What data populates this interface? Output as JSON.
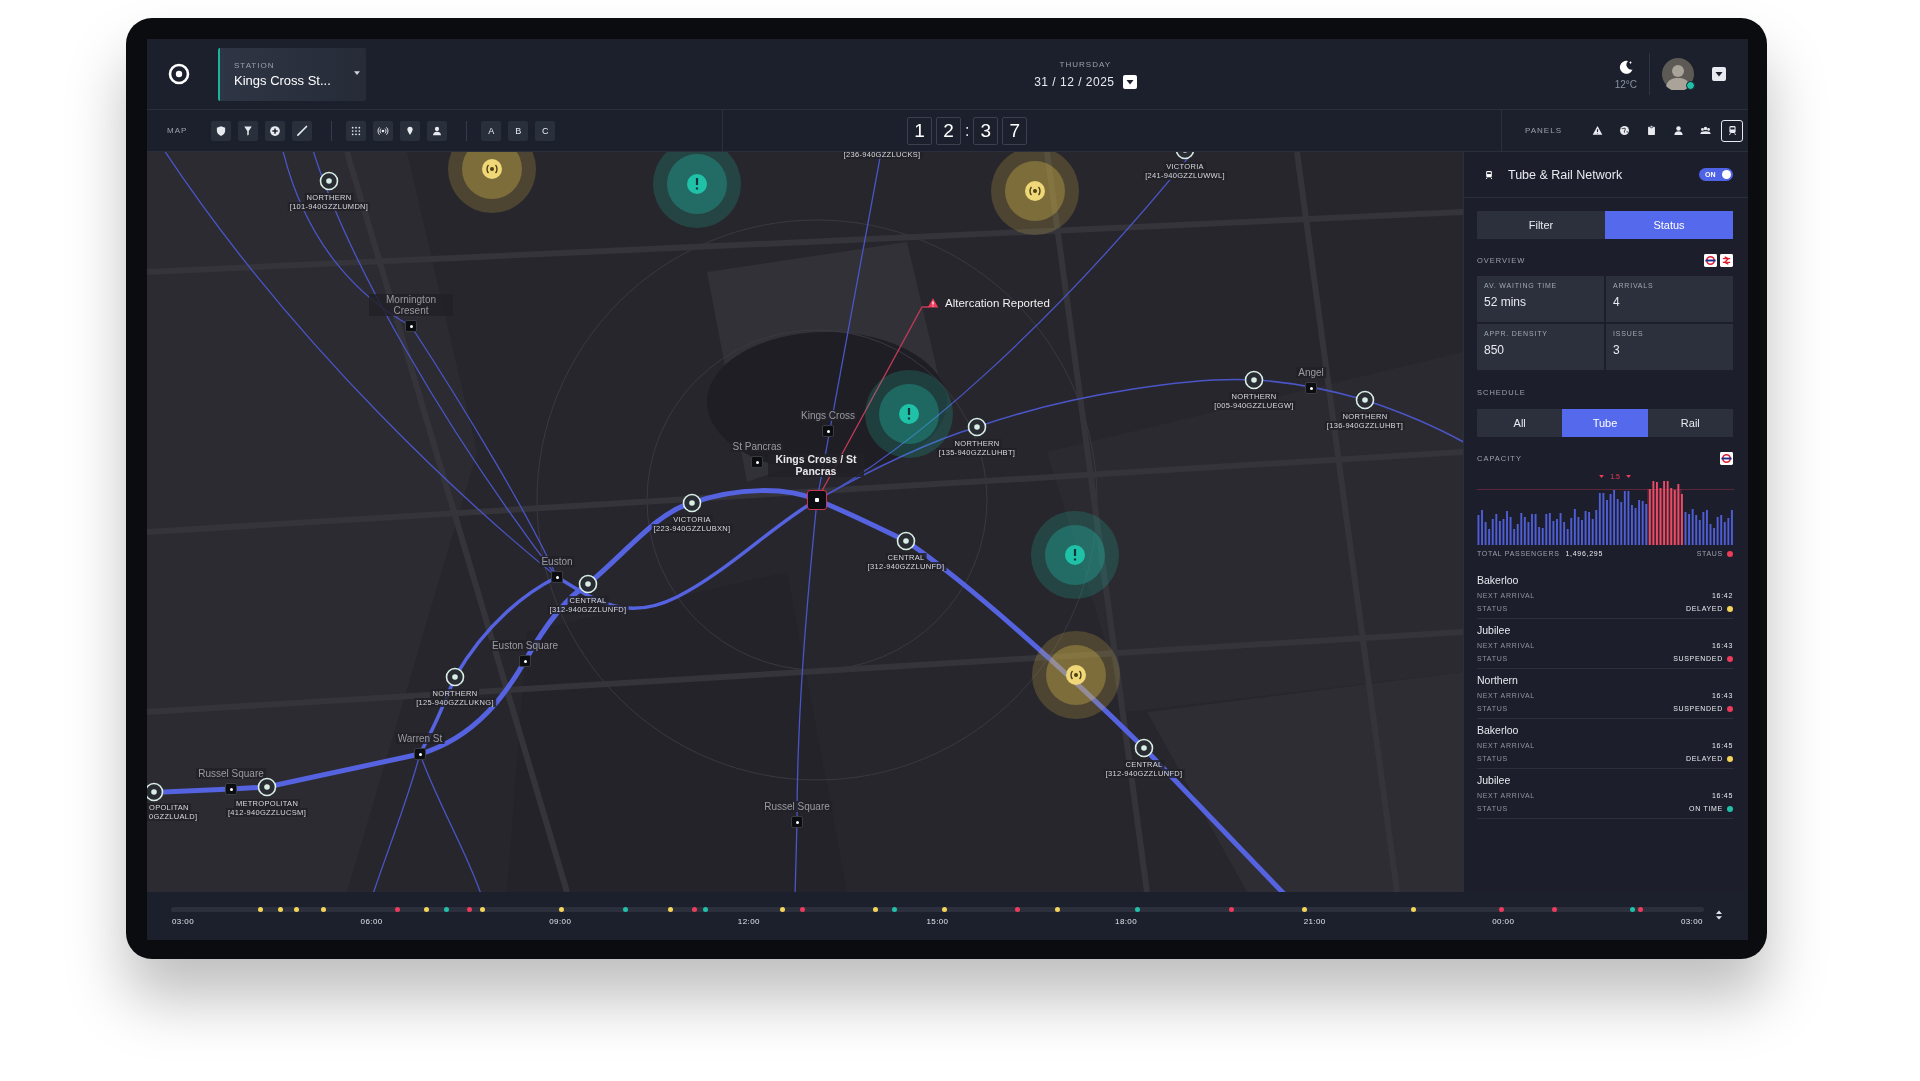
{
  "header": {
    "station_label": "STATION",
    "station": "Kings Cross St...",
    "day": "THURSDAY",
    "date": "31 / 12 / 2025",
    "temperature": "12°C",
    "user_online": true
  },
  "toolbar": {
    "map_label": "MAP",
    "layer_buttons": [
      "A",
      "B",
      "C"
    ],
    "clock": [
      "1",
      "2",
      ":",
      "3",
      "7"
    ],
    "panels_label": "PANELS",
    "panels": [
      {
        "selected": false
      },
      {
        "selected": false
      },
      {
        "selected": false
      },
      {
        "selected": false
      },
      {
        "selected": false
      },
      {
        "selected": true
      }
    ]
  },
  "map": {
    "alert": {
      "text": "Altercation Reported"
    },
    "hub": {
      "name": "Kings Cross / St Pancras"
    },
    "stations": [
      {
        "name": "Mornington Cresent"
      },
      {
        "name": "St Pancras"
      },
      {
        "name": "Kings Cross"
      },
      {
        "name": "Euston"
      },
      {
        "name": "Euston Square"
      },
      {
        "name": "Warren St"
      },
      {
        "name": "Russel Square"
      },
      {
        "name": "Russel Square"
      },
      {
        "name": "Angel"
      }
    ],
    "line_stations": [
      {
        "line": "NORTHERN",
        "code": "[101-940GZZLUMDN]"
      },
      {
        "code": "[236-940GZZLUCKS]"
      },
      {
        "line": "VICTORIA",
        "code": "[241-940GZZLUWWL]"
      },
      {
        "line": "NORTHERN",
        "code": "[005-940GZZLUEGW]"
      },
      {
        "line": "NORTHERN",
        "code": "[136-940GZZLUHBT]"
      },
      {
        "line": "NORTHERN",
        "code": "[135-940GZZLUHBT]"
      },
      {
        "line": "VICTORIA",
        "code": "[223-940GZZLUBXN]"
      },
      {
        "line": "CENTRAL",
        "code": "[312-940GZZLUNFD]"
      },
      {
        "line": "CENTRAL",
        "code": "[312-940GZZLUNFD]"
      },
      {
        "line": "NORTHERN",
        "code": "[125-940GZZLUKNG]"
      },
      {
        "line": "CENTRAL",
        "code": "[312-940GZZLUNFD]"
      },
      {
        "line": "METROPOLITAN",
        "code": "[412-940GZZLUCSM]"
      },
      {
        "line": "OPOLITAN",
        "code": "0GZZLUALD]"
      }
    ],
    "hotspots": [
      {
        "kind": "signal"
      },
      {
        "kind": "alert"
      },
      {
        "kind": "signal"
      },
      {
        "kind": "alert"
      },
      {
        "kind": "alert"
      },
      {
        "kind": "signal"
      }
    ]
  },
  "panel": {
    "title": "Tube & Rail Network",
    "toggle": {
      "label": "ON",
      "on": true
    },
    "view_tabs": [
      {
        "label": "Filter",
        "selected": false
      },
      {
        "label": "Status",
        "selected": true
      }
    ],
    "overview_label": "OVERVIEW",
    "stats": [
      {
        "label": "AV. WAITING TIME",
        "value": "52 mins"
      },
      {
        "label": "ARRIVALS",
        "value": "4"
      },
      {
        "label": "APPR. DENSITY",
        "value": "850"
      },
      {
        "label": "ISSUES",
        "value": "3"
      }
    ],
    "schedule_label": "SCHEDULE",
    "schedule_tabs": [
      {
        "label": "All",
        "selected": false
      },
      {
        "label": "Tube",
        "selected": true
      },
      {
        "label": "Rail",
        "selected": false
      }
    ],
    "capacity_label": "CAPACITY",
    "capacity_marker": "1.5",
    "total_label": "TOTAL PASSENGERS",
    "total_value": "1,496,295",
    "status_label": "STAUS",
    "status_dot": {
      "color": "#ee3b5b"
    },
    "arrivals": [
      {
        "line": "Bakerloo",
        "next_label": "NEXT ARRIVAL",
        "time": "16:42",
        "status_label": "STATUS",
        "status": "DELAYED",
        "color": "#f5d45a"
      },
      {
        "line": "Jubilee",
        "next_label": "NEXT ARRIVAL",
        "time": "16:43",
        "status_label": "STATUS",
        "status": "SUSPENDED",
        "color": "#ee3b5b"
      },
      {
        "line": "Northern",
        "next_label": "NEXT ARRIVAL",
        "time": "16:43",
        "status_label": "STATUS",
        "status": "SUSPENDED",
        "color": "#ee3b5b"
      },
      {
        "line": "Bakerloo",
        "next_label": "NEXT ARRIVAL",
        "time": "16:45",
        "status_label": "STATUS",
        "status": "DELAYED",
        "color": "#f5d45a"
      },
      {
        "line": "Jubilee",
        "next_label": "NEXT ARRIVAL",
        "time": "16:45",
        "status_label": "STATUS",
        "status": "ON TIME",
        "color": "#1fc2a7"
      }
    ]
  },
  "timeline": {
    "times": [
      "03:00",
      "06:00",
      "09:00",
      "12:00",
      "15:00",
      "18:00",
      "21:00",
      "00:00",
      "03:00"
    ],
    "events": [
      {
        "color": "#f5d45a"
      },
      {
        "color": "#f5d45a"
      },
      {
        "color": "#f5d45a"
      },
      {
        "color": "#f5d45a"
      },
      {
        "color": "#ee3b5b"
      },
      {
        "color": "#f5d45a"
      },
      {
        "color": "#1fc2a7"
      },
      {
        "color": "#ee3b5b"
      },
      {
        "color": "#f5d45a"
      },
      {
        "color": "#f5d45a"
      },
      {
        "color": "#1fc2a7"
      },
      {
        "color": "#f5d45a"
      },
      {
        "color": "#ee3b5b"
      },
      {
        "color": "#1fc2a7"
      },
      {
        "color": "#f5d45a"
      },
      {
        "color": "#ee3b5b"
      },
      {
        "color": "#f5d45a"
      },
      {
        "color": "#1fc2a7"
      },
      {
        "color": "#f5d45a"
      },
      {
        "color": "#ee3b5b"
      },
      {
        "color": "#f5d45a"
      },
      {
        "color": "#1fc2a7"
      },
      {
        "color": "#ee3b5b"
      },
      {
        "color": "#f5d45a"
      },
      {
        "color": "#f5d45a"
      },
      {
        "color": "#ee3b5b"
      },
      {
        "color": "#ee3b5b"
      },
      {
        "color": "#1fc2a7"
      },
      {
        "color": "#ee3b5b"
      }
    ]
  }
}
